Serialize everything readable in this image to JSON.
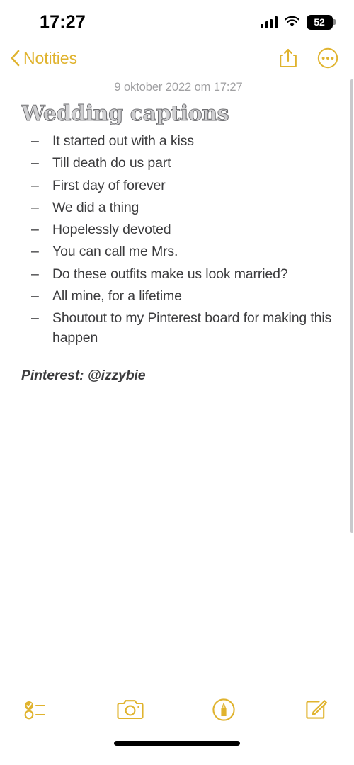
{
  "status_bar": {
    "time": "17:27",
    "signal_icon": "cellular-signal-icon",
    "wifi_icon": "wifi-icon",
    "battery_level": "52",
    "battery_icon": "battery-icon"
  },
  "nav_bar": {
    "back_label": "Notities",
    "back_icon": "chevron-left-icon",
    "share_icon": "share-icon",
    "more_icon": "more-options-icon"
  },
  "note": {
    "date": "9 oktober 2022 om 17:27",
    "title": "Wedding captions",
    "bullet_char": "–",
    "items": [
      "It started out with a kiss",
      "Till death do us part",
      "First day of forever",
      "We did a thing",
      "Hopelessly devoted",
      "You can call me Mrs.",
      "Do these outfits make us look married?",
      "All mine, for a lifetime",
      "Shoutout to my Pinterest board for making this happen"
    ],
    "signature": "Pinterest: @izzybie"
  },
  "toolbar": {
    "checklist_icon": "checklist-icon",
    "camera_icon": "camera-icon",
    "markup_icon": "markup-pen-icon",
    "compose_icon": "compose-icon"
  },
  "colors": {
    "accent": "#E0B32E",
    "body_text": "#3C3C3E",
    "muted_text": "#A0A0A2",
    "background": "#FFFFFF"
  },
  "home_indicator": "home-indicator"
}
